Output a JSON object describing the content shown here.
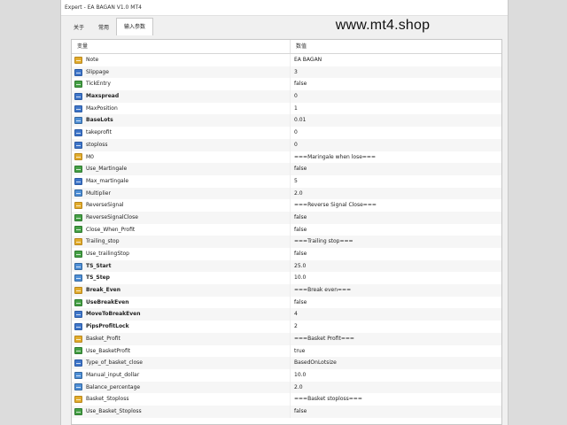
{
  "window": {
    "title": "Expert - EA BAGAN V1.0 MT4",
    "tabs": [
      "关于",
      "常用",
      "输入参数"
    ],
    "active_tab": 2
  },
  "watermark": "www.mt4.shop",
  "table": {
    "headers": [
      "变量",
      "数值"
    ],
    "rows": [
      {
        "name": "Note",
        "value": "EA BAGAN",
        "type": "str",
        "bold": false
      },
      {
        "name": "Slippage",
        "value": "3",
        "type": "int",
        "bold": false
      },
      {
        "name": "TickEntry",
        "value": "false",
        "type": "bool",
        "bold": false
      },
      {
        "name": "Maxspread",
        "value": "0",
        "type": "int",
        "bold": true
      },
      {
        "name": "MaxPosition",
        "value": "1",
        "type": "int",
        "bold": false
      },
      {
        "name": "BaseLots",
        "value": "0.01",
        "type": "dbl",
        "bold": true
      },
      {
        "name": "takeprofit",
        "value": "0",
        "type": "int",
        "bold": false
      },
      {
        "name": "stoploss",
        "value": "0",
        "type": "int",
        "bold": false
      },
      {
        "name": "M0",
        "value": "===Maringale when lose===",
        "type": "str",
        "bold": false
      },
      {
        "name": "Use_Martingale",
        "value": "false",
        "type": "bool",
        "bold": false
      },
      {
        "name": "Max_martingale",
        "value": "5",
        "type": "int",
        "bold": false
      },
      {
        "name": "Multiplier",
        "value": "2.0",
        "type": "dbl",
        "bold": false
      },
      {
        "name": "ReverseSignal",
        "value": "===Reverse Signal Close===",
        "type": "str",
        "bold": false
      },
      {
        "name": "ReverseSignalClose",
        "value": "false",
        "type": "bool",
        "bold": false
      },
      {
        "name": "Close_When_Profit",
        "value": "false",
        "type": "bool",
        "bold": false
      },
      {
        "name": "Trailing_stop",
        "value": "===Trailing stop===",
        "type": "str",
        "bold": false
      },
      {
        "name": "Use_trailingStop",
        "value": "false",
        "type": "bool",
        "bold": false
      },
      {
        "name": "TS_Start",
        "value": "25.0",
        "type": "dbl",
        "bold": true
      },
      {
        "name": "TS_Step",
        "value": "10.0",
        "type": "dbl",
        "bold": true
      },
      {
        "name": "Break_Even",
        "value": "===Break even===",
        "type": "str",
        "bold": true
      },
      {
        "name": "UseBreakEven",
        "value": "false",
        "type": "bool",
        "bold": true
      },
      {
        "name": "MoveToBreakEven",
        "value": "4",
        "type": "int",
        "bold": true
      },
      {
        "name": "PipsProfitLock",
        "value": "2",
        "type": "int",
        "bold": true
      },
      {
        "name": "Basket_Profit",
        "value": "===Basket Profit===",
        "type": "str",
        "bold": false
      },
      {
        "name": "Use_BasketProfit",
        "value": "true",
        "type": "bool",
        "bold": false
      },
      {
        "name": "Type_of_basket_close",
        "value": "BasedOnLotsize",
        "type": "int",
        "bold": false
      },
      {
        "name": "Manual_input_dollar",
        "value": "10.0",
        "type": "dbl",
        "bold": false
      },
      {
        "name": "Balance_percentage",
        "value": "2.0",
        "type": "dbl",
        "bold": false
      },
      {
        "name": "Basket_Stoploss",
        "value": "===Basket stoploss===",
        "type": "str",
        "bold": false
      },
      {
        "name": "Use_Basket_Stoploss",
        "value": "false",
        "type": "bool",
        "bold": false
      }
    ]
  }
}
